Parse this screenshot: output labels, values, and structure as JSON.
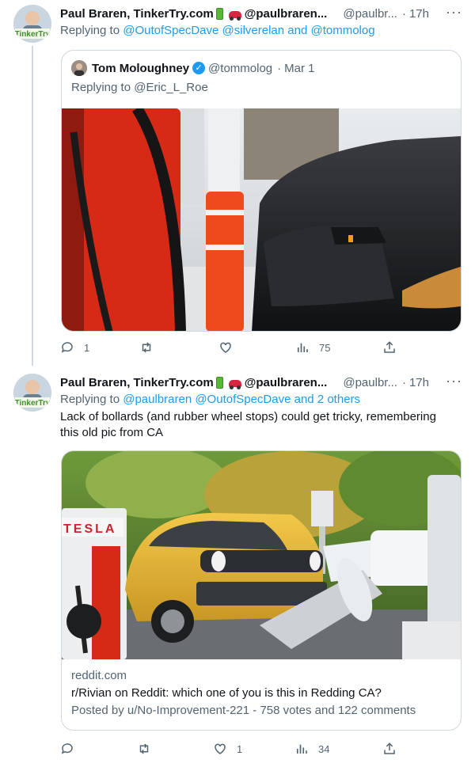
{
  "tweet1": {
    "author": "Paul Braren, TinkerTry.com",
    "handle_full": "@paulbraren...",
    "handle_short": "@paulbr...",
    "time": "17h",
    "reply_prefix": "Replying to",
    "reply_users": "@OutofSpecDave @silverelan",
    "reply_and": "and",
    "reply_last": "@tommolog",
    "quote": {
      "author": "Tom Moloughney",
      "handle": "@tommolog",
      "date": "Mar 1",
      "reply_prefix": "Replying to",
      "reply_user": "@Eric_L_Roe"
    },
    "stats": {
      "replies": "1",
      "retweets": "",
      "likes": "",
      "views": "75"
    }
  },
  "tweet2": {
    "author": "Paul Braren, TinkerTry.com",
    "handle_full": "@paulbraren...",
    "handle_short": "@paulbr...",
    "time": "17h",
    "reply_prefix": "Replying to",
    "reply_users": "@paulbraren @OutofSpecDave",
    "reply_and": "and",
    "reply_last": "2 others",
    "text": "Lack of bollards (and rubber wheel stops) could get tricky, remembering this old pic from CA",
    "card": {
      "domain": "reddit.com",
      "title": "r/Rivian on Reddit: which one of you is this in Redding CA?",
      "description": "Posted by u/No-Improvement-221 - 758 votes and 122 comments",
      "sign_text": "TESLA"
    },
    "stats": {
      "replies": "",
      "retweets": "",
      "likes": "1",
      "views": "34"
    }
  },
  "avatar_text": "TinkerTry",
  "icons": [
    "reply-icon",
    "retweet-icon",
    "like-icon",
    "views-icon",
    "share-icon",
    "more-icon",
    "verified-icon"
  ],
  "colors": {
    "link": "#1d9bf0",
    "muted": "#536471",
    "border": "#cfd9de"
  }
}
